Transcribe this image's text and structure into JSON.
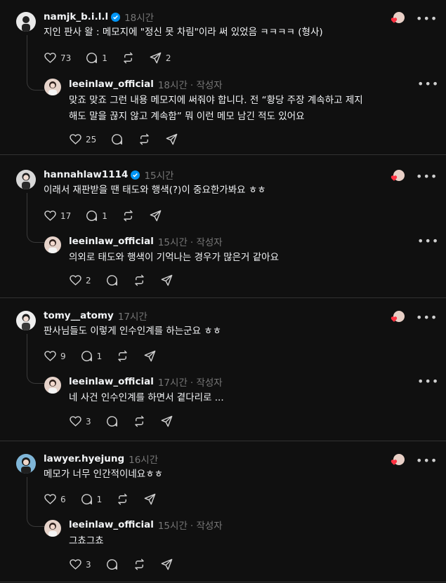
{
  "threads": [
    {
      "comment": {
        "username": "namjk_b.i.l.l",
        "verified": true,
        "time": "18시간",
        "text": "지인 판사 왈 : 메모지에 \"정신 못 차림\"이라 써 있었음 ㅋㅋㅋㅋ (형사)",
        "likes": "73",
        "replies": "1",
        "reposts": "",
        "shares": "2"
      },
      "reply": {
        "username": "leeinlaw_official",
        "time": "18시간",
        "author_badge": "· 작성자",
        "text_lines": [
          "맞죠 맞죠 그런 내용 메모지에 써줘야 합니다. 전 “황당 주장 계속하고 제지",
          "해도 말을 끊지 않고 계속함” 뭐 이런 메모 남긴 적도 있어요"
        ],
        "likes": "25",
        "replies": "",
        "reposts": "",
        "shares": ""
      }
    },
    {
      "comment": {
        "username": "hannahlaw1114",
        "verified": true,
        "time": "15시간",
        "text": "이래서 재판받을 땐 태도와 행색(?)이 중요한가봐요 ㅎㅎ",
        "likes": "17",
        "replies": "1",
        "reposts": "",
        "shares": ""
      },
      "reply": {
        "username": "leeinlaw_official",
        "time": "15시간",
        "author_badge": "· 작성자",
        "text_lines": [
          "의외로 태도와 행색이 기억나는 경우가 많은거 같아요"
        ],
        "likes": "2",
        "replies": "",
        "reposts": "",
        "shares": ""
      }
    },
    {
      "comment": {
        "username": "tomy__atomy",
        "verified": false,
        "time": "17시간",
        "text": "판사님들도 이렇게 인수인계를 하는군요 ㅎㅎ",
        "likes": "9",
        "replies": "1",
        "reposts": "",
        "shares": ""
      },
      "reply": {
        "username": "leeinlaw_official",
        "time": "17시간",
        "author_badge": "· 작성자",
        "text_lines": [
          "네 사건 인수인계를 하면서 곁다리로 ..."
        ],
        "likes": "3",
        "replies": "",
        "reposts": "",
        "shares": ""
      }
    },
    {
      "comment": {
        "username": "lawyer.hyejung",
        "verified": false,
        "time": "16시간",
        "text": "메모가 너무 인간적이네요ㅎㅎ",
        "likes": "6",
        "replies": "1",
        "reposts": "",
        "shares": ""
      },
      "reply": {
        "username": "leeinlaw_official",
        "time": "15시간",
        "author_badge": "· 작성자",
        "text_lines": [
          "그쵸그쵸"
        ],
        "likes": "3",
        "replies": "",
        "reposts": "",
        "shares": ""
      }
    }
  ],
  "colors": {
    "background": "#101010",
    "verified": "#0095f6",
    "liked_heart": "#ff3040",
    "muted": "#777777"
  },
  "icons": [
    "heart-icon",
    "comment-icon",
    "repost-icon",
    "share-icon",
    "more-icon",
    "verified-badge-icon"
  ]
}
